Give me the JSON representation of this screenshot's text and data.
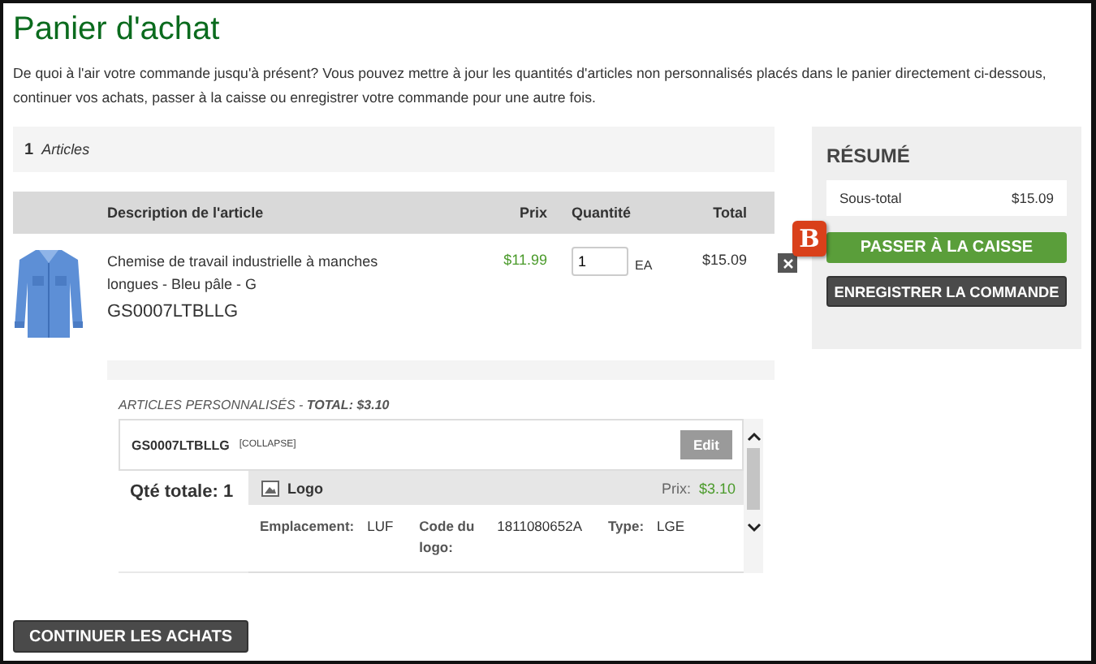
{
  "title": "Panier d'achat",
  "intro": "De quoi à l'air votre commande jusqu'à présent? Vous pouvez mettre à jour les quantités d'articles non personnalisés placés dans le panier directement ci-dessous, continuer vos achats, passer à la caisse ou enregistrer votre commande pour une autre fois.",
  "cart": {
    "count": "1",
    "count_label": "Articles",
    "columns": [
      "Description de l'article",
      "Prix",
      "Quantité",
      "Total"
    ],
    "items": [
      {
        "name": "Chemise de travail industrielle à manches longues - Bleu pâle - G",
        "sku": "GS0007LTBLLG",
        "price": "$11.99",
        "quantity": "1",
        "unit": "EA",
        "total": "$15.09"
      }
    ],
    "customized": {
      "heading": "ARTICLES PERSONNALISÉS - **TOTAL: $3.10**",
      "sku": "GS0007LTBLLG",
      "toggle": "[COLLAPSE]",
      "edit": "Edit",
      "total_qty": "Qté totale: 1",
      "decoration": {
        "name": "Logo",
        "price_label": "Prix:",
        "price": "$3.10",
        "fields": [
          {
            "label": "Emplacement:",
            "value": "LUF"
          },
          {
            "label": "Code du logo:",
            "value": "1811080652A"
          },
          {
            "label": "Type:",
            "value": "LGE"
          }
        ]
      }
    }
  },
  "summary": {
    "title": "RÉSUMÉ",
    "subtotal_label": "Sous-total",
    "subtotal": "$15.09",
    "badge": "B",
    "buttons": [
      {
        "label": "PASSER À LA CAISSE",
        "kind": "primary"
      },
      {
        "label": "ENREGISTRER LA COMMANDE",
        "kind": "secondary"
      }
    ]
  },
  "continue_button": "CONTINUER LES ACHATS"
}
